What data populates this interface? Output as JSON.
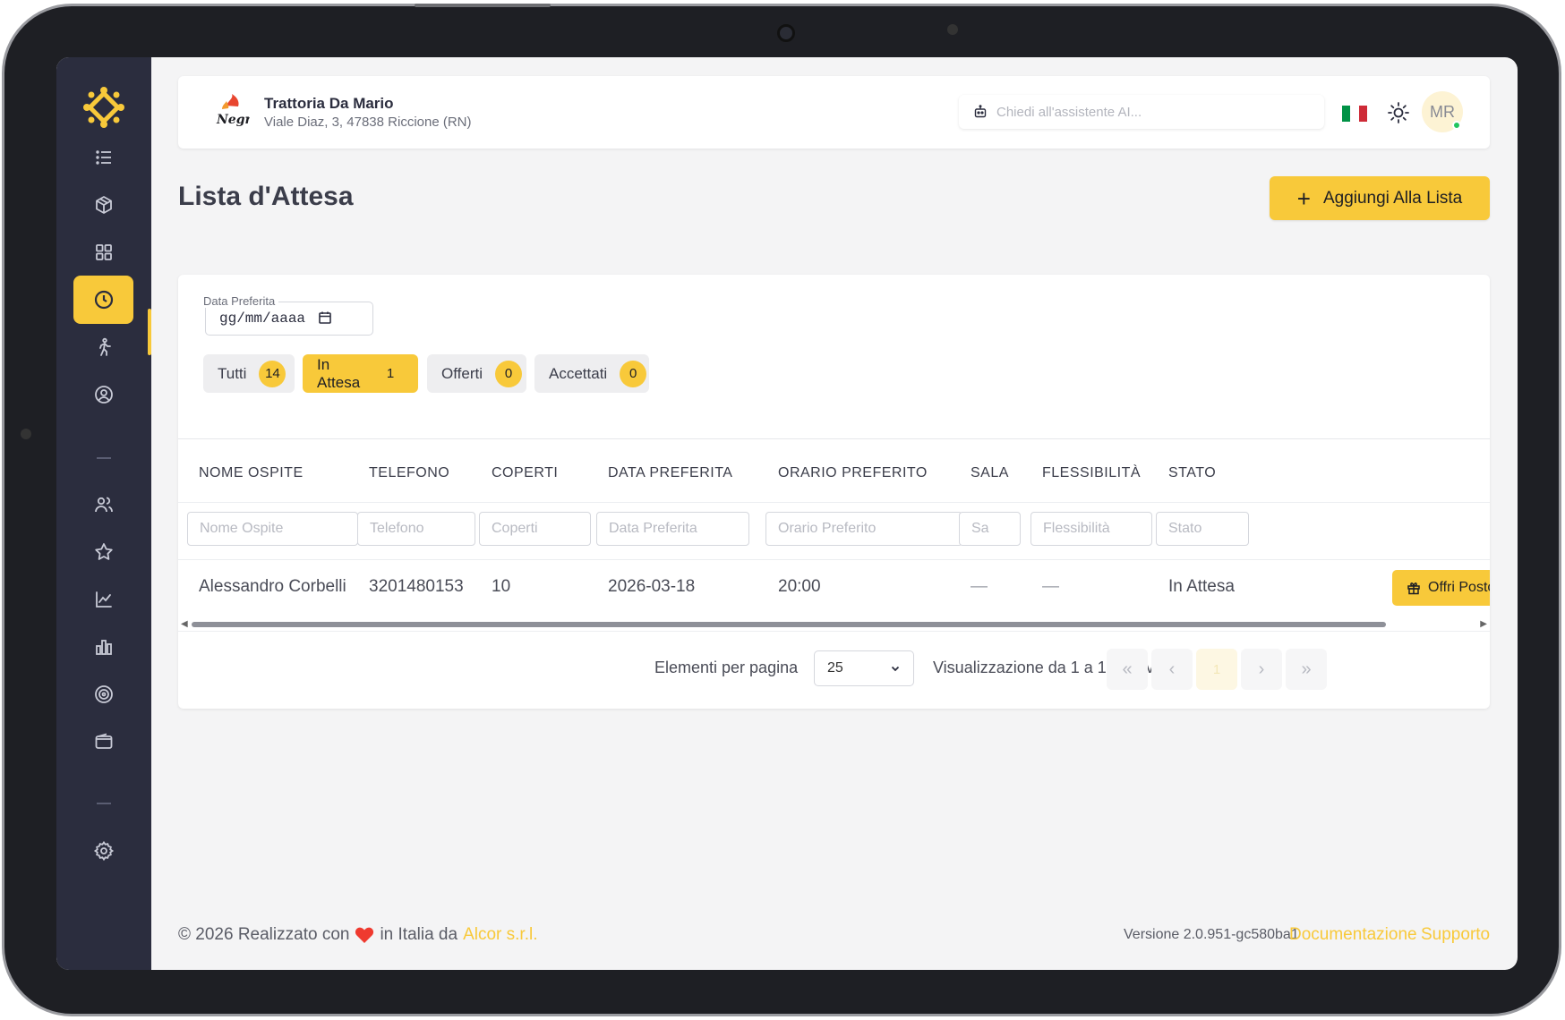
{
  "restaurant": {
    "name": "Trattoria Da Mario",
    "address": "Viale Diaz, 3, 47838 Riccione (RN)",
    "logo_text": "Negri"
  },
  "header": {
    "ai_placeholder": "Chiedi all'assistente AI...",
    "avatar_initials": "MR",
    "flag_colors": [
      "#009246",
      "#ffffff",
      "#ce2b37"
    ]
  },
  "sidebar": {
    "items": [
      {
        "icon": "list-icon"
      },
      {
        "icon": "package-icon"
      },
      {
        "icon": "grid-icon"
      },
      {
        "icon": "clock-icon",
        "active": true
      },
      {
        "icon": "walking-icon"
      },
      {
        "icon": "user-circle-icon"
      },
      {
        "icon": "users-icon"
      },
      {
        "icon": "star-icon"
      },
      {
        "icon": "line-chart-icon"
      },
      {
        "icon": "bar-chart-icon"
      },
      {
        "icon": "target-icon"
      },
      {
        "icon": "wallet-icon"
      },
      {
        "icon": "gear-icon"
      }
    ]
  },
  "page": {
    "title": "Lista d'Attesa",
    "add_button": "Aggiungi Alla Lista"
  },
  "date_filter": {
    "label": "Data Preferita",
    "value": "gg/mm/aaaa"
  },
  "filters": [
    {
      "label": "Tutti",
      "count": "14"
    },
    {
      "label": "In Attesa",
      "count": "1",
      "active": true
    },
    {
      "label": "Offerti",
      "count": "0"
    },
    {
      "label": "Accettati",
      "count": "0"
    }
  ],
  "table": {
    "columns": [
      "NOME OSPITE",
      "TELEFONO",
      "COPERTI",
      "DATA PREFERITA",
      "ORARIO PREFERITO",
      "SALA",
      "FLESSIBILITÀ",
      "STATO"
    ],
    "filter_placeholders": [
      "Nome Ospite",
      "Telefono",
      "Coperti",
      "Data Preferita",
      "Orario Preferito",
      "Sa",
      "Flessibilità",
      "Stato"
    ],
    "rows": [
      {
        "nome": "Alessandro Corbelli",
        "telefono": "3201480153",
        "coperti": "10",
        "data": "2026-03-18",
        "orario": "20:00",
        "sala": "—",
        "flessibilita": "—",
        "stato": "In Attesa",
        "action": "Offri Posto"
      }
    ]
  },
  "pagination": {
    "per_page_label": "Elementi per pagina",
    "per_page_value": "25",
    "showing": "Visualizzazione da 1 a 1 su 1 voci",
    "first": "«",
    "prev": "‹",
    "current": "1",
    "next": "›",
    "last": "»"
  },
  "footer": {
    "copyright_pre": "© 2026 Realizzato con",
    "copyright_post": "in Italia da",
    "company": "Alcor s.r.l.",
    "version": "Versione 2.0.951-gc580ba1",
    "docs": "Documentazione",
    "support": "Supporto"
  },
  "colors": {
    "accent": "#f8c93a",
    "sidebar": "#2b2d3e",
    "online": "#22c55e"
  }
}
